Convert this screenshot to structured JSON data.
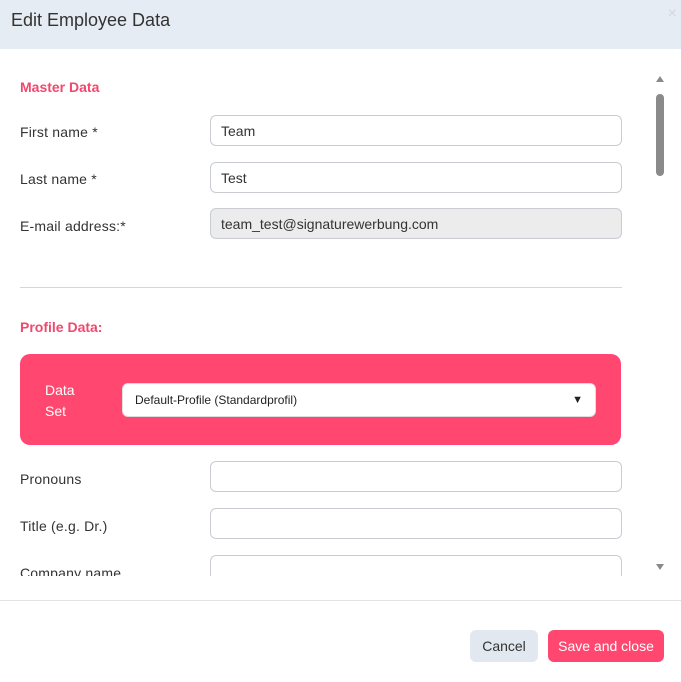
{
  "dialog": {
    "title": "Edit Employee Data",
    "close_glyph": "×"
  },
  "master": {
    "title": "Master Data",
    "fields": [
      {
        "label": "First name *",
        "value": "Team"
      },
      {
        "label": "Last name *",
        "value": "Test"
      },
      {
        "label": "E-mail address:*",
        "value": "team_test@signaturewerbung.com"
      }
    ]
  },
  "profile": {
    "title": "Profile Data:",
    "dataset_label": "Data Set",
    "dataset_value": "Default-Profile (Standardprofil)",
    "fields": [
      {
        "label": "Pronouns",
        "value": ""
      },
      {
        "label": "Title (e.g. Dr.)",
        "value": ""
      },
      {
        "label": "Company name",
        "value": ""
      }
    ]
  },
  "footer": {
    "cancel_label": "Cancel",
    "save_label": "Save and close"
  },
  "colors": {
    "accent": "#ff476f",
    "header_bg": "#e6ecf3"
  }
}
